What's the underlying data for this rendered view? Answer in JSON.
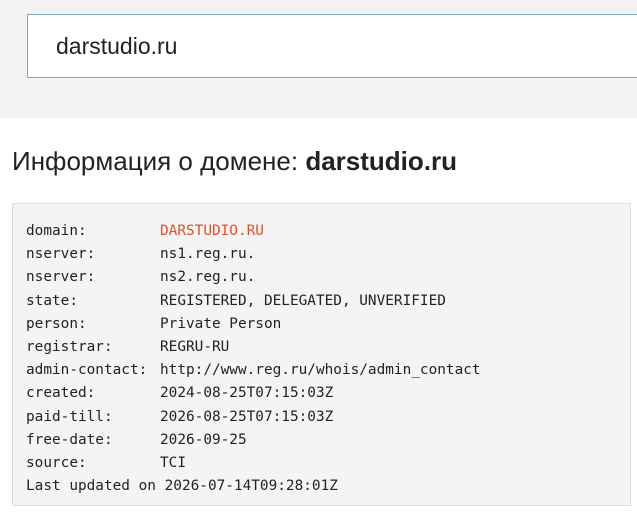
{
  "search": {
    "value": "darstudio.ru"
  },
  "heading": {
    "prefix": "Информация о домене: ",
    "domain": "darstudio.ru"
  },
  "whois": {
    "highlight_color": "#e2502a",
    "rows": [
      {
        "key": "domain:",
        "value": "DARSTUDIO.RU"
      },
      {
        "key": "nserver:",
        "value": "ns1.reg.ru."
      },
      {
        "key": "nserver:",
        "value": "ns2.reg.ru."
      },
      {
        "key": "state:",
        "value": "REGISTERED, DELEGATED, UNVERIFIED"
      },
      {
        "key": "person:",
        "value": "Private Person"
      },
      {
        "key": "registrar:",
        "value": "REGRU-RU"
      },
      {
        "key": "admin-contact:",
        "value": "http://www.reg.ru/whois/admin_contact"
      },
      {
        "key": "created:",
        "value": "2024-08-25T07:15:03Z"
      },
      {
        "key": "paid-till:",
        "value": "2026-08-25T07:15:03Z"
      },
      {
        "key": "free-date:",
        "value": "2026-09-25"
      },
      {
        "key": "source:",
        "value": "TCI"
      }
    ],
    "last_updated": "Last updated on 2026-07-14T09:28:01Z"
  }
}
